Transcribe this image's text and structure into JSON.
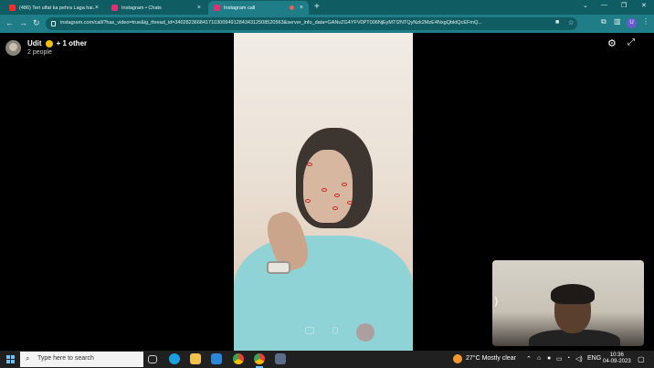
{
  "browser": {
    "tabs": [
      {
        "title": "(486) Teri ulfat ka pehra Laga hai...",
        "favicon_color": "#ff2b2b",
        "active": false
      },
      {
        "title": "Instagram • Chats",
        "favicon_color": "#e1306c",
        "active": false
      },
      {
        "title": "Instagram call",
        "favicon_color": "#e1306c",
        "active": true
      }
    ],
    "close_glyph": "×",
    "new_tab_glyph": "+",
    "url": "instagram.com/call/?has_video=true&ig_thread_id=340282366841710300949128434312508520563&server_info_data=GANvZG4YFV0PT006NjEyMTI2NTQyNzk2MzE4NxgQbktQcEFmQ...",
    "profile_initial": "U",
    "window_controls": [
      "⌄",
      "—",
      "❐",
      "✕"
    ]
  },
  "call": {
    "caller_name": "Udit",
    "others": "+ 1 other",
    "people_count": "2 people"
  },
  "taskbar": {
    "search_placeholder": "Type here to search",
    "weather": "27°C  Mostly clear",
    "language": "ENG",
    "time": "10:36",
    "date": "04-09-2023"
  },
  "colors": {
    "tab_strip": "#0f5c63",
    "toolbar": "#1e7d86",
    "taskbar": "#202020",
    "accent": "#6cc3ff"
  }
}
